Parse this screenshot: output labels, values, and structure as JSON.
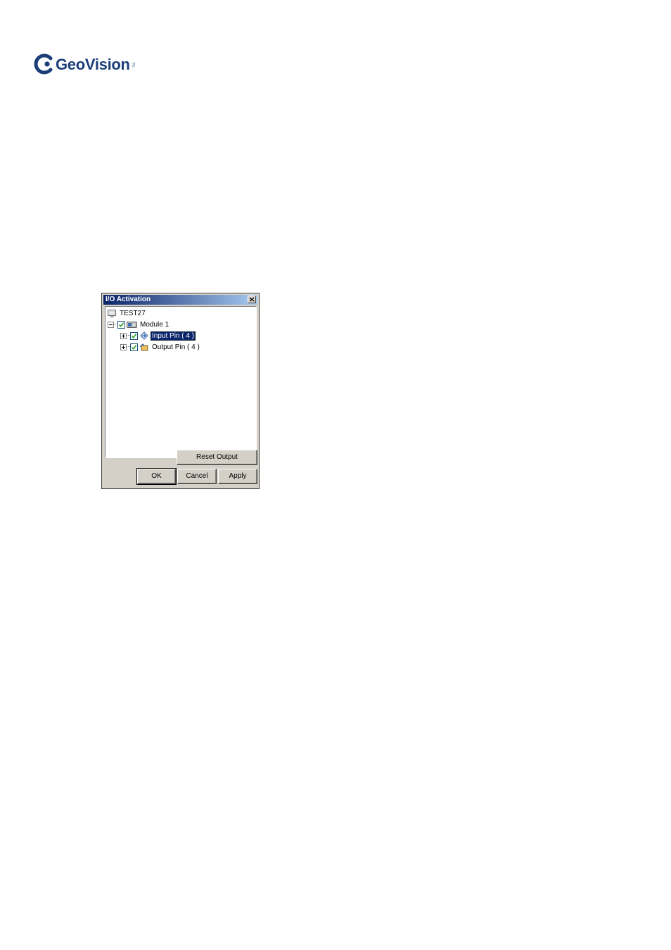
{
  "brand": {
    "name": "GeoVision",
    "suffix": "Inc."
  },
  "dialog": {
    "title": "I/O Activation",
    "tree": [
      {
        "label": "TEST27",
        "icon": "computer-icon",
        "level": 0
      },
      {
        "label": "Module 1",
        "icon": "io-module-icon",
        "level": 1,
        "checked": true,
        "expanded": true
      },
      {
        "label": "Input Pin ( 4 )",
        "icon": "input-pin-icon",
        "level": 2,
        "checked": true,
        "expanded": false,
        "selected": true
      },
      {
        "label": "Output Pin ( 4 )",
        "icon": "output-pin-icon",
        "level": 2,
        "checked": true,
        "expanded": false
      }
    ],
    "buttons": {
      "reset_output": "Reset Output",
      "ok": "OK",
      "cancel": "Cancel",
      "apply": "Apply"
    }
  },
  "colors": {
    "brand_blue": "#1b3e78",
    "titlebar_start": "#0a246a",
    "titlebar_end": "#a6caf0",
    "selection": "#0a246a",
    "dialog_face": "#d4d0c8",
    "check_green": "#21a121"
  }
}
